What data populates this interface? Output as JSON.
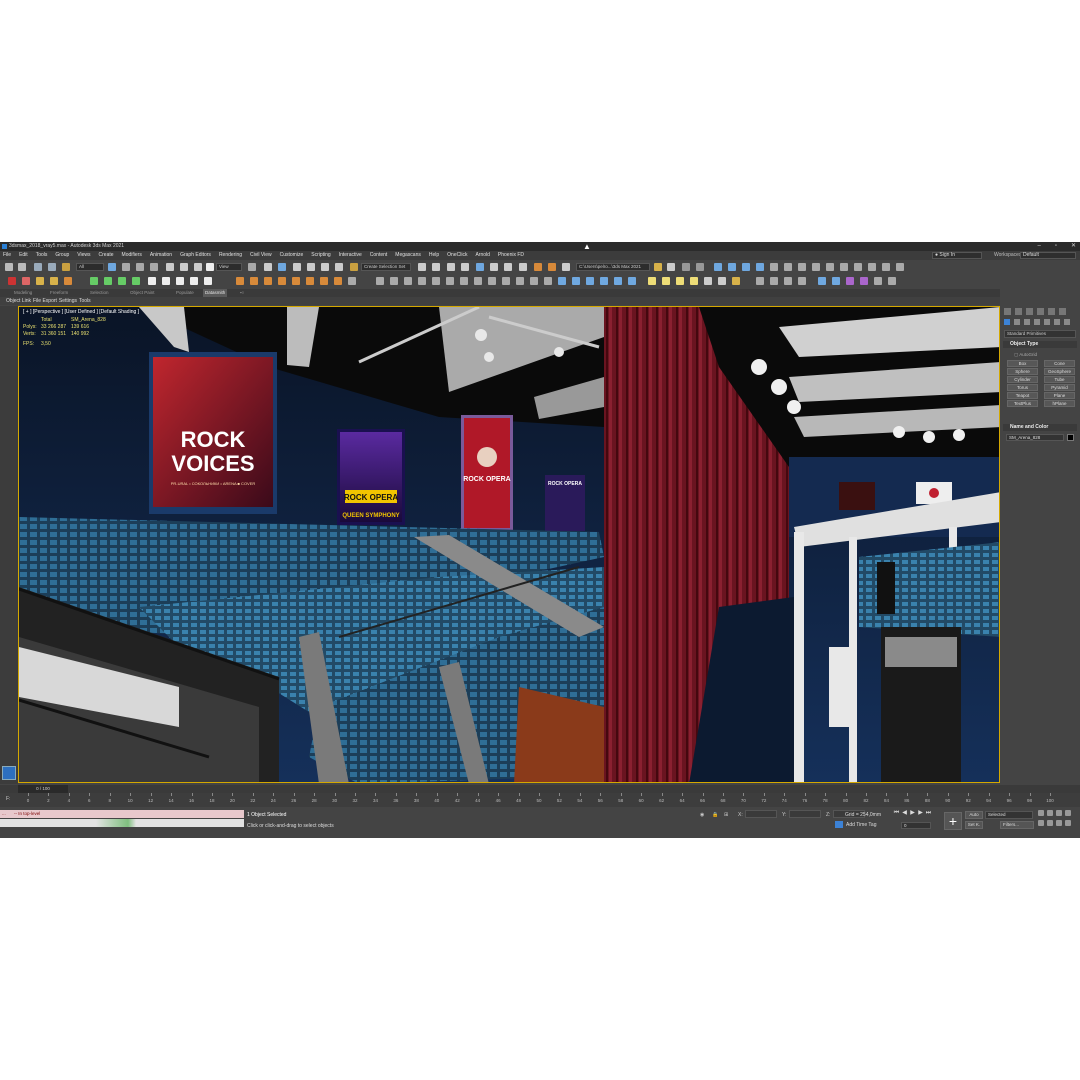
{
  "window": {
    "title": "3dsmax_2018_vray5.max - Autodesk 3ds Max 2021"
  },
  "menu": [
    "File",
    "Edit",
    "Tools",
    "Group",
    "Views",
    "Create",
    "Modifiers",
    "Animation",
    "Graph Editors",
    "Rendering",
    "Civil View",
    "Customize",
    "Scripting",
    "Interactive",
    "Content",
    "Megascans",
    "Help",
    "OneClick",
    "Arnold",
    "Phoenix FD"
  ],
  "signin": "Sign In",
  "workspaces_label": "Workspaces:",
  "workspace_value": "Default",
  "toolbar": {
    "selection_filter": "All",
    "view_dropdown": "View",
    "selection_set": "Create Selection Set",
    "project_path": "C:\\Users\\pelro...\\3ds Max 2021"
  },
  "ribbon_tabs": [
    "Modeling",
    "Freeform",
    "Selection",
    "Object Paint",
    "Populate",
    "Datasmith"
  ],
  "ribbon_active": "Datasmith",
  "subbar": [
    "Object Link",
    "File Export",
    "Settings",
    "Tools"
  ],
  "viewport": {
    "label": "[ + ] [Perspective ] [User Defined ] [Default Shading ]",
    "stats": {
      "header": [
        "",
        "Total",
        "SM_Arena_828"
      ],
      "polys": [
        "Polys:",
        "33 266 287",
        "139 616"
      ],
      "verts": [
        "Verts:",
        "31 360 151",
        "140 992"
      ],
      "fps": [
        "FPS:",
        "3,50"
      ]
    },
    "posters": {
      "rock_voices_title": "ROCK VOICES",
      "rock_voices_title_line1": "ROCK",
      "rock_voices_title_line2": "VOICES",
      "rock_voices_subtitle": "PR-URAL • СОКОЛЬНИКИ • ARENA ■ COVER",
      "rock_opera_left": "ROCK OPERA",
      "queen_symphony": "QUEEN SYMPHONY",
      "rock_opera_right": "ROCK OPERA",
      "rock_opera_far": "ROCK OPERA"
    }
  },
  "command_panel": {
    "dropdown": "Standard Primitives",
    "object_type_title": "Object Type",
    "autogrid": "AutoGrid",
    "object_buttons": [
      "Box",
      "Cone",
      "Sphere",
      "GeoSphere",
      "Cylinder",
      "Tube",
      "Torus",
      "Pyramid",
      "Teapot",
      "Plane",
      "TextPlus",
      "hPlane"
    ],
    "name_color_title": "Name and Color",
    "name_value": "SM_Arena_828"
  },
  "timeline": {
    "frame_counter": "0 / 100",
    "ticks": [
      "0",
      "2",
      "4",
      "6",
      "8",
      "10",
      "12",
      "14",
      "16",
      "18",
      "20",
      "22",
      "24",
      "26",
      "28",
      "30",
      "32",
      "34",
      "36",
      "38",
      "40",
      "42",
      "44",
      "46",
      "48",
      "50",
      "52",
      "54",
      "56",
      "58",
      "60",
      "62",
      "64",
      "66",
      "68",
      "70",
      "72",
      "74",
      "76",
      "78",
      "80",
      "82",
      "84",
      "86",
      "88",
      "90",
      "92",
      "94",
      "96",
      "98",
      "100"
    ]
  },
  "status": {
    "maxscript_line1": "-- In top-level",
    "maxscript_prompt": "...",
    "selection": "1 Object Selected",
    "prompt": "Click or click-and-drag to select objects",
    "x_label": "X:",
    "y_label": "Y:",
    "z_label": "Z:",
    "grid": "Grid = 254,0mm",
    "add_time_tag": "Add Time Tag",
    "frame_field": "0",
    "auto_key": "Auto",
    "set_key": "Set K.",
    "selected_dd": "Selected",
    "filters": "Filters..."
  },
  "colors": {
    "viewport_border": "#d4a800",
    "active_tab": "#3c82d6",
    "curtain": "#6e1620",
    "seats": "#2f6e96"
  }
}
